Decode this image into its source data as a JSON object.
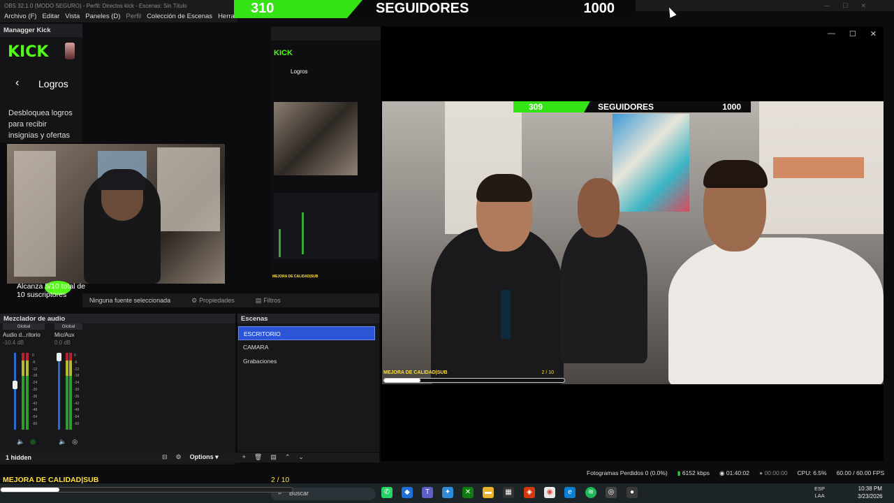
{
  "titlebar": {
    "text": "OBS 32.1.0 (MODO SEGURO) - Perfil: Directos kick - Escenas: Sin Título"
  },
  "menu": [
    "Archivo (F)",
    "Editar",
    "Vista",
    "Paneles (D)",
    "Perfil",
    "Colección de Escenas",
    "Herramientas"
  ],
  "goal_overlay": {
    "count": "310",
    "label": "SEGUIDORES",
    "target": "1000",
    "progress": 0.31,
    "color": "#35e215"
  },
  "kick_dock": {
    "title": "Managger Kick",
    "logo": "KICK",
    "back_icon": "chevron-left-icon",
    "section": "Logros",
    "description": "Desbloquea logros para recibir insignias y ofertas"
  },
  "camera_overlay_text": "Alcanza 5/10 total de 10 suscriptores",
  "source_bar": {
    "none_selected": "Ninguna fuente seleccionada",
    "properties": "Propiedades",
    "filters": "Filtros"
  },
  "mixer": {
    "title": "Mezclador de audio",
    "channels": [
      {
        "group": "Global",
        "name": "Audio d...ritorio",
        "db": "-10.4 dB",
        "level": 0.62
      },
      {
        "group": "Global",
        "name": "Mic/Aux",
        "db": "0.0 dB",
        "level": 1.0
      }
    ],
    "scale": [
      "0",
      "-6",
      "-12",
      "-18",
      "-24",
      "-30",
      "-36",
      "-42",
      "-48",
      "-54",
      "-60"
    ]
  },
  "hidden_bar": {
    "label": "1 hidden",
    "options": "Options"
  },
  "scenes": {
    "title": "Escenas",
    "items": [
      "ESCRITORIO",
      "CAMARA",
      "Grabaciones"
    ],
    "active_index": 0
  },
  "stream_preview": {
    "goal": {
      "count": "309",
      "label": "SEGUIDORES",
      "target": "1000"
    },
    "progress": {
      "label": "MEJORA DE CALIDAD|SUB",
      "count": "2 / 10",
      "value": 0.2
    }
  },
  "status": {
    "dropped": "Fotogramas Perdidos 0 (0.0%)",
    "bitrate": "6152 kbps",
    "live_time": "01:40:02",
    "rec_time": "00:00:00",
    "cpu": "CPU: 6.5%",
    "fps": "60.00 / 60.00 FPS"
  },
  "bottom_overlay": {
    "label": "MEJORA DE CALIDAD|SUB",
    "count": "2 / 10",
    "value": 0.2
  },
  "taskbar": {
    "search": "Buscar",
    "lang_top": "ESP",
    "lang_bottom": "LAA",
    "time": "10:38 PM",
    "date": "3/23/2026"
  },
  "colors": {
    "accent": "#2b54d6",
    "kick_green": "#53fc18",
    "yellow": "#ffe033"
  }
}
